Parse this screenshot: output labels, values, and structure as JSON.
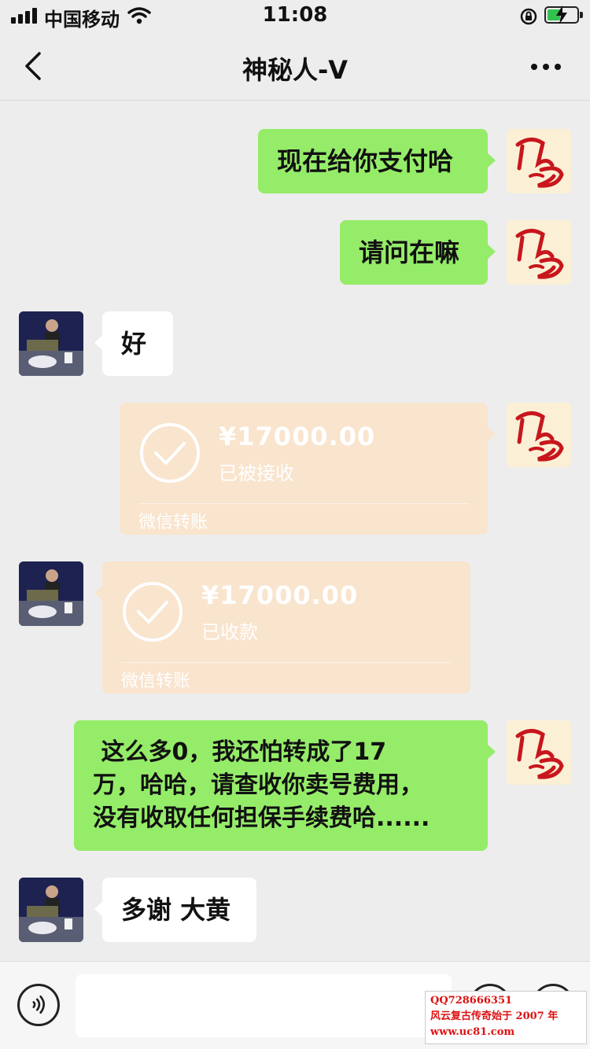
{
  "status_bar": {
    "carrier": "中国移动",
    "time": "11:08"
  },
  "nav": {
    "title": "神秘人-V"
  },
  "messages": [
    {
      "sender": "me",
      "type": "text",
      "text": "现在给你支付哈"
    },
    {
      "sender": "me",
      "type": "text",
      "text": "请问在嘛"
    },
    {
      "sender": "other",
      "type": "text",
      "text": "好"
    },
    {
      "sender": "me",
      "type": "transfer",
      "amount": "¥17000.00",
      "status": "已被接收",
      "footer": "微信转账"
    },
    {
      "sender": "other",
      "type": "transfer",
      "amount": "¥17000.00",
      "status": "已收款",
      "footer": "微信转账"
    },
    {
      "sender": "me",
      "type": "text",
      "lines": [
        " 这么多0，我还怕转成了17",
        "万，哈哈，请查收你卖号费用，",
        "没有收取任何担保手续费哈......"
      ]
    },
    {
      "sender": "other",
      "type": "text",
      "text": "多谢 大黄"
    }
  ],
  "avatars": {
    "me_logo_text": "风云"
  },
  "input": {
    "value": ""
  },
  "watermark": {
    "line1": "QQ728666351",
    "line2": "风云复古传奇始于 2007 年",
    "line3": "www.uc81.com"
  },
  "colors": {
    "background": "#ededed",
    "my_bubble": "#95ec69",
    "other_bubble": "#ffffff",
    "transfer_card": "#f9e4cd",
    "logo_red": "#c8161d"
  }
}
